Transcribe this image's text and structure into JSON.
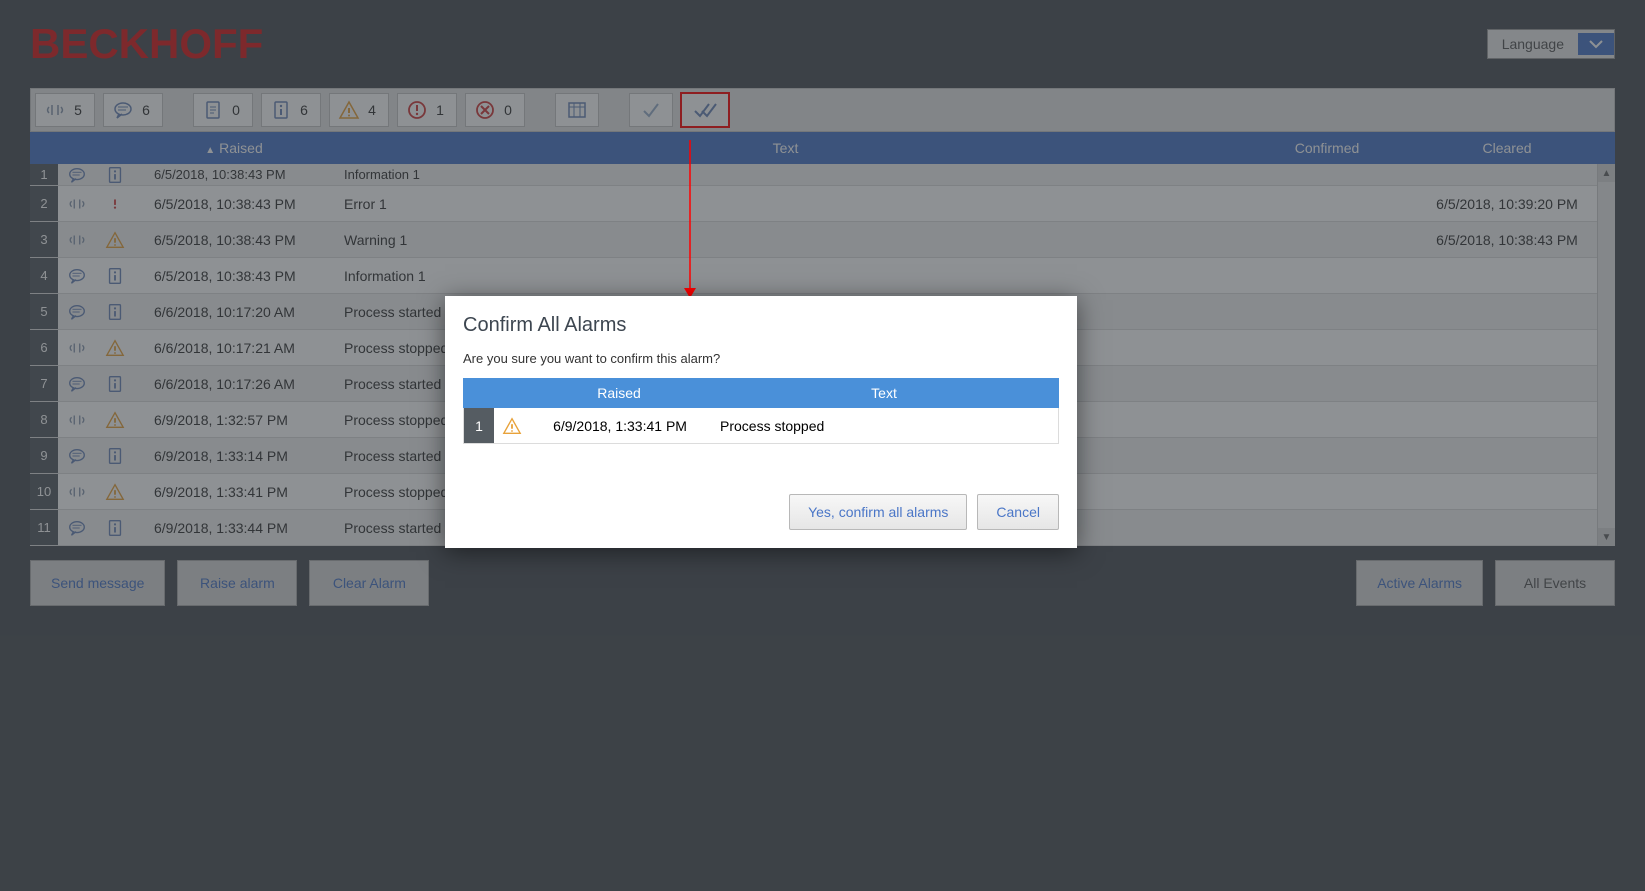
{
  "header": {
    "logo": "BECKHOFF",
    "lang_label": "Language"
  },
  "toolbar": {
    "counts": {
      "alarm": "5",
      "message": "6",
      "doc": "0",
      "info": "6",
      "warning": "4",
      "error": "1",
      "cancel": "0"
    }
  },
  "table": {
    "headers": {
      "raised": "Raised",
      "text": "Text",
      "confirmed": "Confirmed",
      "cleared": "Cleared"
    },
    "rows": [
      {
        "num": "1",
        "type": "message",
        "icon2": "info",
        "raised": "6/5/2018, 10:38:43 PM",
        "text": "Information 1",
        "confirmed": "",
        "cleared": "",
        "first": true
      },
      {
        "num": "2",
        "type": "alarm",
        "icon2": "error",
        "raised": "6/5/2018, 10:38:43 PM",
        "text": "Error 1",
        "confirmed": "",
        "cleared": "6/5/2018, 10:39:20 PM"
      },
      {
        "num": "3",
        "type": "alarm",
        "icon2": "warning",
        "raised": "6/5/2018, 10:38:43 PM",
        "text": "Warning 1",
        "confirmed": "",
        "cleared": "6/5/2018, 10:38:43 PM"
      },
      {
        "num": "4",
        "type": "message",
        "icon2": "info",
        "raised": "6/5/2018, 10:38:43 PM",
        "text": "Information 1",
        "confirmed": "",
        "cleared": ""
      },
      {
        "num": "5",
        "type": "message",
        "icon2": "info",
        "raised": "6/6/2018, 10:17:20 AM",
        "text": "Process started",
        "confirmed": "",
        "cleared": ""
      },
      {
        "num": "6",
        "type": "alarm",
        "icon2": "warning",
        "raised": "6/6/2018, 10:17:21 AM",
        "text": "Process stopped",
        "confirmed": "",
        "cleared": ""
      },
      {
        "num": "7",
        "type": "message",
        "icon2": "info",
        "raised": "6/6/2018, 10:17:26 AM",
        "text": "Process started",
        "confirmed": "",
        "cleared": ""
      },
      {
        "num": "8",
        "type": "alarm",
        "icon2": "warning",
        "raised": "6/9/2018, 1:32:57 PM",
        "text": "Process stopped",
        "confirmed": "",
        "cleared": ""
      },
      {
        "num": "9",
        "type": "message",
        "icon2": "info",
        "raised": "6/9/2018, 1:33:14 PM",
        "text": "Process started",
        "confirmed": "",
        "cleared": ""
      },
      {
        "num": "10",
        "type": "alarm",
        "icon2": "warning",
        "raised": "6/9/2018, 1:33:41 PM",
        "text": "Process stopped",
        "confirmed": "",
        "cleared": ""
      },
      {
        "num": "11",
        "type": "message",
        "icon2": "info",
        "raised": "6/9/2018, 1:33:44 PM",
        "text": "Process started",
        "confirmed": "",
        "cleared": ""
      }
    ]
  },
  "footer": {
    "send": "Send message",
    "raise": "Raise alarm",
    "clear": "Clear Alarm",
    "active": "Active Alarms",
    "all": "All Events"
  },
  "dialog": {
    "title": "Confirm All Alarms",
    "message": "Are you sure you want to confirm this alarm?",
    "headers": {
      "raised": "Raised",
      "text": "Text"
    },
    "row": {
      "num": "1",
      "raised": "6/9/2018, 1:33:41 PM",
      "text": "Process stopped"
    },
    "yes": "Yes, confirm all alarms",
    "cancel": "Cancel"
  }
}
